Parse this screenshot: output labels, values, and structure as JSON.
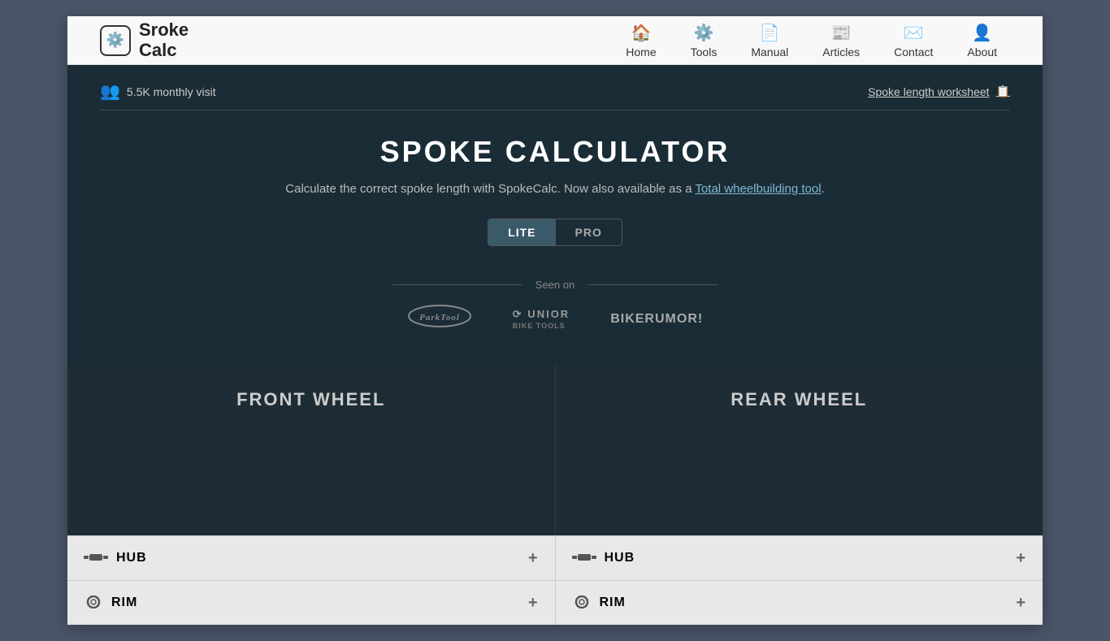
{
  "header": {
    "logo_text_line1": "Sroke",
    "logo_text_line2": "Calc",
    "nav": [
      {
        "label": "Home",
        "icon": "🏠",
        "name": "home"
      },
      {
        "label": "Tools",
        "icon": "⚙️",
        "name": "tools"
      },
      {
        "label": "Manual",
        "icon": "📄",
        "name": "manual"
      },
      {
        "label": "Articles",
        "icon": "📰",
        "name": "articles"
      },
      {
        "label": "Contact",
        "icon": "✉️",
        "name": "contact"
      },
      {
        "label": "About",
        "icon": "👤",
        "name": "about"
      }
    ]
  },
  "hero": {
    "visitors_count": "5.5K monthly visit",
    "worksheet_label": "Spoke length worksheet",
    "title": "SPOKE CALCULATOR",
    "description_before": "Calculate the correct spoke length with SpokeCalc. Now also available as a ",
    "description_link": "Total wheelbuilding tool",
    "description_after": ".",
    "toggle": {
      "lite_label": "LITE",
      "pro_label": "PRO"
    },
    "seen_on_label": "Seen on",
    "brands": [
      {
        "name": "Park Tool",
        "class": "parktool"
      },
      {
        "name": "⟳ UNIOR BIKE TOOLS",
        "class": "unior"
      },
      {
        "name": "BIKERUMOR!",
        "class": "bikerumor"
      }
    ]
  },
  "front_wheel": {
    "title": "FRONT WHEEL",
    "hub_label": "HUB",
    "rim_label": "RIM"
  },
  "rear_wheel": {
    "title": "REAR WHEEL",
    "hub_label": "HUB",
    "rim_label": "RIM"
  }
}
